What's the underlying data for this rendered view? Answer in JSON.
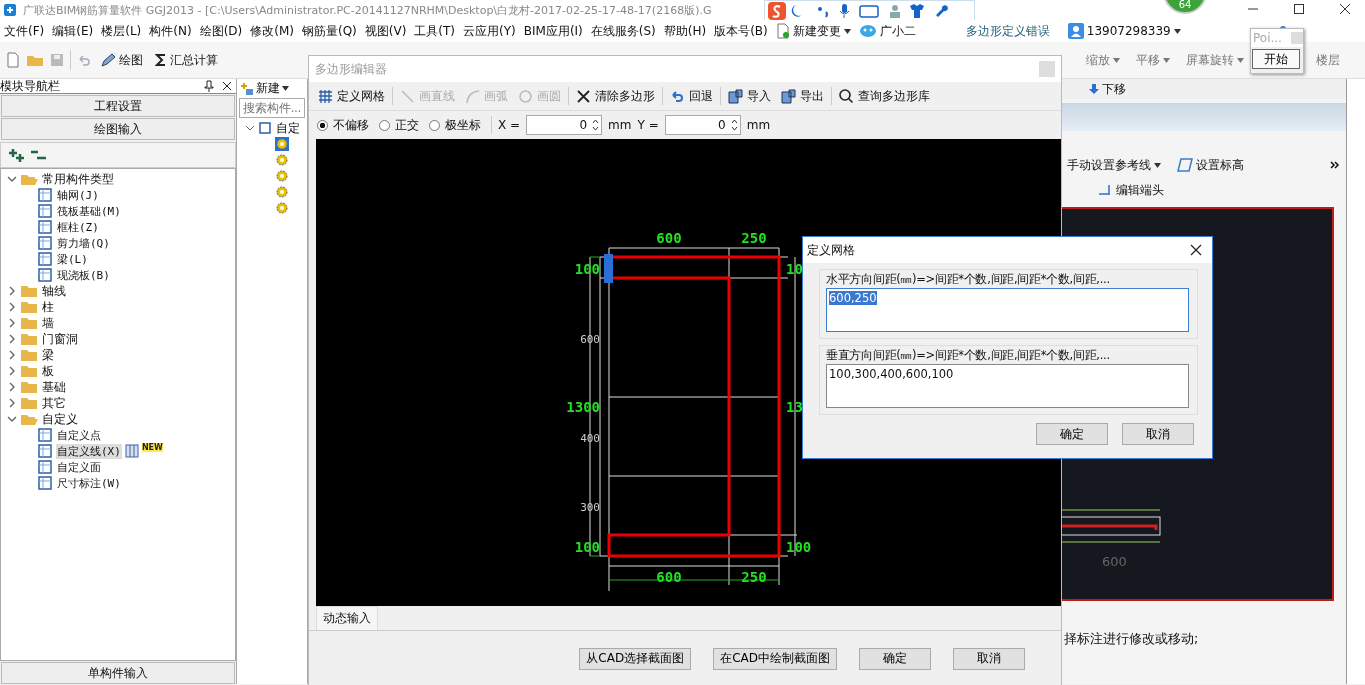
{
  "app": {
    "title": "广联达BIM钢筋算量软件 GGJ2013 - [C:\\Users\\Administrator.PC-20141127NRHM\\Desktop\\白龙村-2017-02-25-17-48-17(2168版).G",
    "badge": "64"
  },
  "menu": [
    "文件(F)",
    "编辑(E)",
    "楼层(L)",
    "构件(N)",
    "绘图(D)",
    "修改(M)",
    "钢筋量(Q)",
    "视图(V)",
    "工具(T)",
    "云应用(Y)",
    "BIM应用(I)",
    "在线服务(S)",
    "帮助(H)",
    "版本号(B)"
  ],
  "menu_extras": {
    "change": "新建变更",
    "assistant": "广小二",
    "error_link": "多边形定义错误",
    "account": "13907298339"
  },
  "toolbar": {
    "draw": "绘图",
    "calc": "汇总计算",
    "right_tools": [
      "缩放",
      "平移",
      "屏幕旋转"
    ],
    "floor": "楼层",
    "move_down": "下移"
  },
  "popup": {
    "title": "Poi...",
    "button": "开始"
  },
  "nav": {
    "title": "模块导航栏",
    "sections": [
      "工程设置",
      "绘图输入"
    ],
    "tree": [
      {
        "label": "常用构件类型",
        "expanded": true,
        "selected": false,
        "children": [
          {
            "label": "轴网(J)",
            "selected": false
          },
          {
            "label": "筏板基础(M)",
            "selected": false
          },
          {
            "label": "框柱(Z)",
            "selected": false
          },
          {
            "label": "剪力墙(Q)",
            "selected": false
          },
          {
            "label": "梁(L)",
            "selected": false
          },
          {
            "label": "现浇板(B)",
            "selected": false
          }
        ]
      },
      {
        "label": "轴线",
        "expanded": false,
        "selected": false
      },
      {
        "label": "柱",
        "expanded": false,
        "selected": false
      },
      {
        "label": "墙",
        "expanded": false,
        "selected": false
      },
      {
        "label": "门窗洞",
        "expanded": false,
        "selected": false
      },
      {
        "label": "梁",
        "expanded": false,
        "selected": false
      },
      {
        "label": "板",
        "expanded": false,
        "selected": false
      },
      {
        "label": "基础",
        "expanded": false,
        "selected": false
      },
      {
        "label": "其它",
        "expanded": false,
        "selected": false
      },
      {
        "label": "自定义",
        "expanded": true,
        "selected": false,
        "children": [
          {
            "label": "自定义点",
            "selected": false
          },
          {
            "label": "自定义线(X)",
            "selected": true,
            "badge": "NEW"
          },
          {
            "label": "自定义面",
            "selected": false
          },
          {
            "label": "尺寸标注(W)",
            "selected": false
          }
        ]
      }
    ],
    "bottom_section": "单构件输入"
  },
  "component_panel": {
    "new": "新建",
    "search_placeholder": "搜索构件...",
    "root": "自定",
    "items": [
      {
        "selected": true
      },
      {
        "selected": false
      },
      {
        "selected": false
      },
      {
        "selected": false
      },
      {
        "selected": false
      }
    ]
  },
  "editor": {
    "title": "多边形编辑器",
    "tools": [
      {
        "label": "定义网格",
        "disabled": false
      },
      {
        "label": "画直线",
        "disabled": true
      },
      {
        "label": "画弧",
        "disabled": true
      },
      {
        "label": "画圆",
        "disabled": true
      },
      {
        "label": "清除多边形",
        "disabled": false
      },
      {
        "label": "回退",
        "disabled": false
      },
      {
        "label": "导入",
        "disabled": false
      },
      {
        "label": "导出",
        "disabled": false
      },
      {
        "label": "查询多边形库",
        "disabled": false
      }
    ],
    "snap_modes": [
      {
        "label": "不偏移",
        "selected": true
      },
      {
        "label": "正交",
        "selected": false
      },
      {
        "label": "极坐标",
        "selected": false
      }
    ],
    "x_label": "X =",
    "x_value": "0",
    "x_unit": "mm",
    "y_label": "Y =",
    "y_value": "0",
    "y_unit": "mm",
    "canvas": {
      "top_dims": [
        "600",
        "250"
      ],
      "bottom_dims": [
        "600",
        "250"
      ],
      "left_dims": [
        "100",
        "600",
        "1300",
        "400",
        "300",
        "100"
      ],
      "right_dims": [
        "10",
        "13",
        "100"
      ]
    },
    "tab": "动态输入",
    "buttons": [
      "从CAD选择截面图",
      "在CAD中绘制截面图",
      "确定",
      "取消"
    ]
  },
  "grid_dialog": {
    "title": "定义网格",
    "fields": [
      {
        "label": "水平方向间距(㎜)=>间距*个数,间距,间距*个数,间距,...",
        "value": "600,250",
        "selected": true
      },
      {
        "label": "垂直方向间距(㎜)=>间距*个数,间距,间距*个数,间距,...",
        "value": "100,300,400,600,100",
        "selected": false
      }
    ],
    "buttons": [
      "确定",
      "取消"
    ]
  },
  "right_panel": {
    "tools": [
      "手动设置参考线",
      "设置标高"
    ],
    "edit_end": "编辑端头",
    "ref_dim": "600",
    "hint": "择标注进行修改或移动;"
  }
}
